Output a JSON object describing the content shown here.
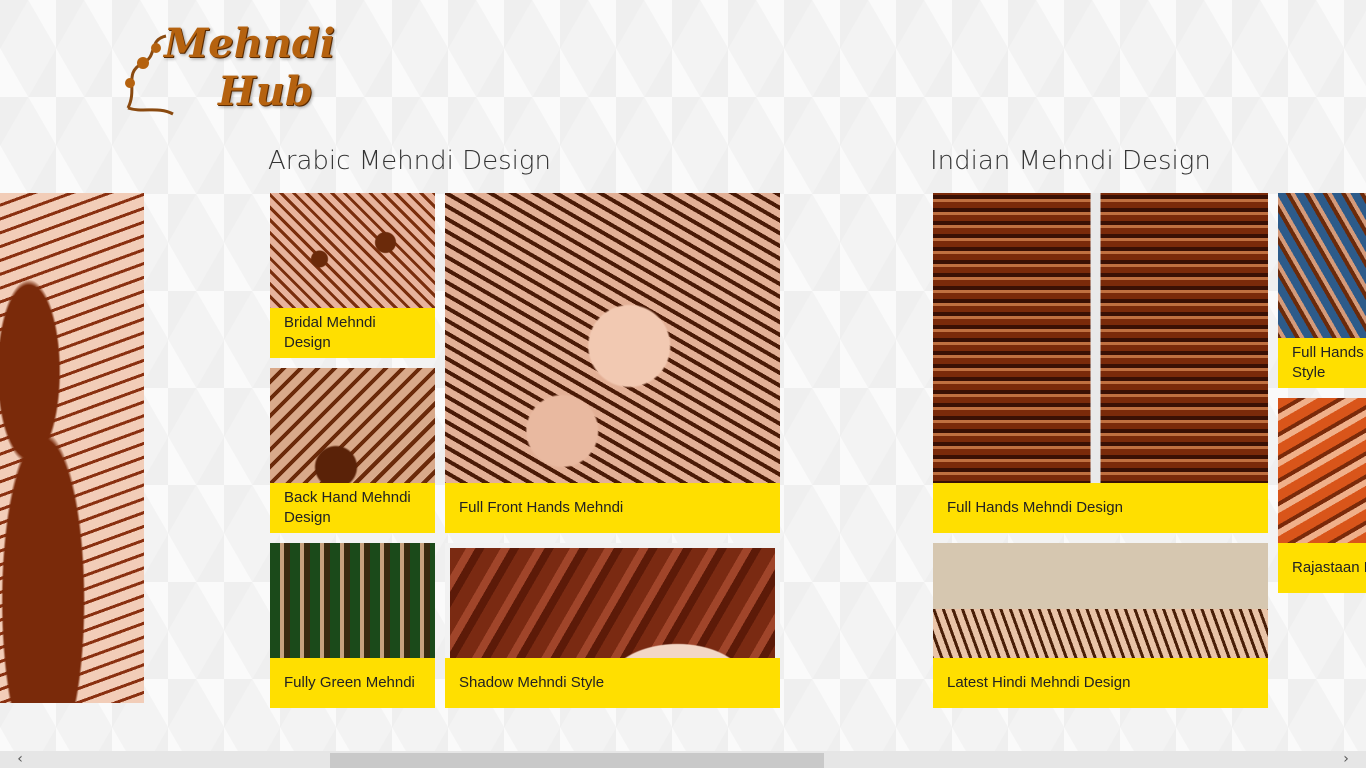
{
  "logo": {
    "line1": "Mehndi",
    "line2": "Hub",
    "color": "#b5620f"
  },
  "sections": [
    {
      "title": "Arabic Mehndi Design",
      "tiles": [
        {
          "label": "Bridal Mehndi Design"
        },
        {
          "label": "Full Front Hands Mehndi"
        },
        {
          "label": "Back Hand Mehndi Design"
        },
        {
          "label": "Fully Green Mehndi"
        },
        {
          "label": "Shadow Mehndi Style"
        }
      ]
    },
    {
      "title": "Indian Mehndi Design",
      "tiles": [
        {
          "label": "Full Hands Mehndi Design"
        },
        {
          "label": "Latest Hindi Mehndi Design"
        },
        {
          "label": "Full Hands Mehndi Style"
        },
        {
          "label": "Rajastaan Mehndi"
        }
      ]
    }
  ],
  "scrollbar": {
    "left_arrow": "‹",
    "right_arrow": "›"
  },
  "colors": {
    "caption_bg": "#ffdf00",
    "caption_text": "#222222",
    "background": "#f3f3f3"
  }
}
